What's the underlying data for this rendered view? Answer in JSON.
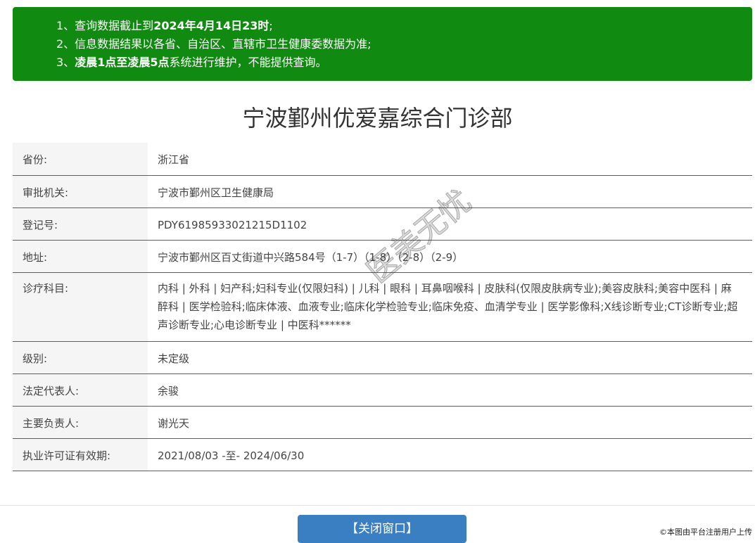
{
  "notice": {
    "line1": {
      "prefix": "1、查询数据截止到",
      "bold": "2024年4月14日23时",
      "suffix": ";"
    },
    "line2": "2、信息数据结果以各省、自治区、直辖市卫生健康委数据为准;",
    "line3": {
      "prefix": "3、",
      "bold": "凌晨1点至凌晨5点",
      "suffix": "系统进行维护，不能提供查询。"
    }
  },
  "title": "宁波鄞州优爱嘉综合门诊部",
  "rows": [
    {
      "label": "省份:",
      "value": "浙江省"
    },
    {
      "label": "审批机关:",
      "value": "宁波市鄞州区卫生健康局"
    },
    {
      "label": "登记号:",
      "value": "PDY61985933021215D1102"
    },
    {
      "label": "地址:",
      "value": "宁波市鄞州区百丈街道中兴路584号（1-7）（1-8）（2-8）（2-9）"
    },
    {
      "label": "诊疗科目:",
      "value": "内科 | 外科 | 妇产科;妇科专业(仅限妇科) | 儿科 | 眼科 | 耳鼻咽喉科 | 皮肤科(仅限皮肤病专业);美容皮肤科;美容中医科 | 麻醉科 | 医学检验科;临床体液、血液专业;临床化学检验专业;临床免疫、血清学专业 | 医学影像科;X线诊断专业;CT诊断专业;超声诊断专业;心电诊断专业 | 中医科******"
    },
    {
      "label": "级别:",
      "value": "未定级"
    },
    {
      "label": "法定代表人:",
      "value": "余骏"
    },
    {
      "label": "主要负责人:",
      "value": "谢光天"
    },
    {
      "label": "执业许可证有效期:",
      "value": "2021/08/03 -至- 2024/06/30"
    }
  ],
  "close_button": "【关闭窗口】",
  "stamp_text": "医美无忧",
  "copyright": "©本图由平台注册用户上传"
}
